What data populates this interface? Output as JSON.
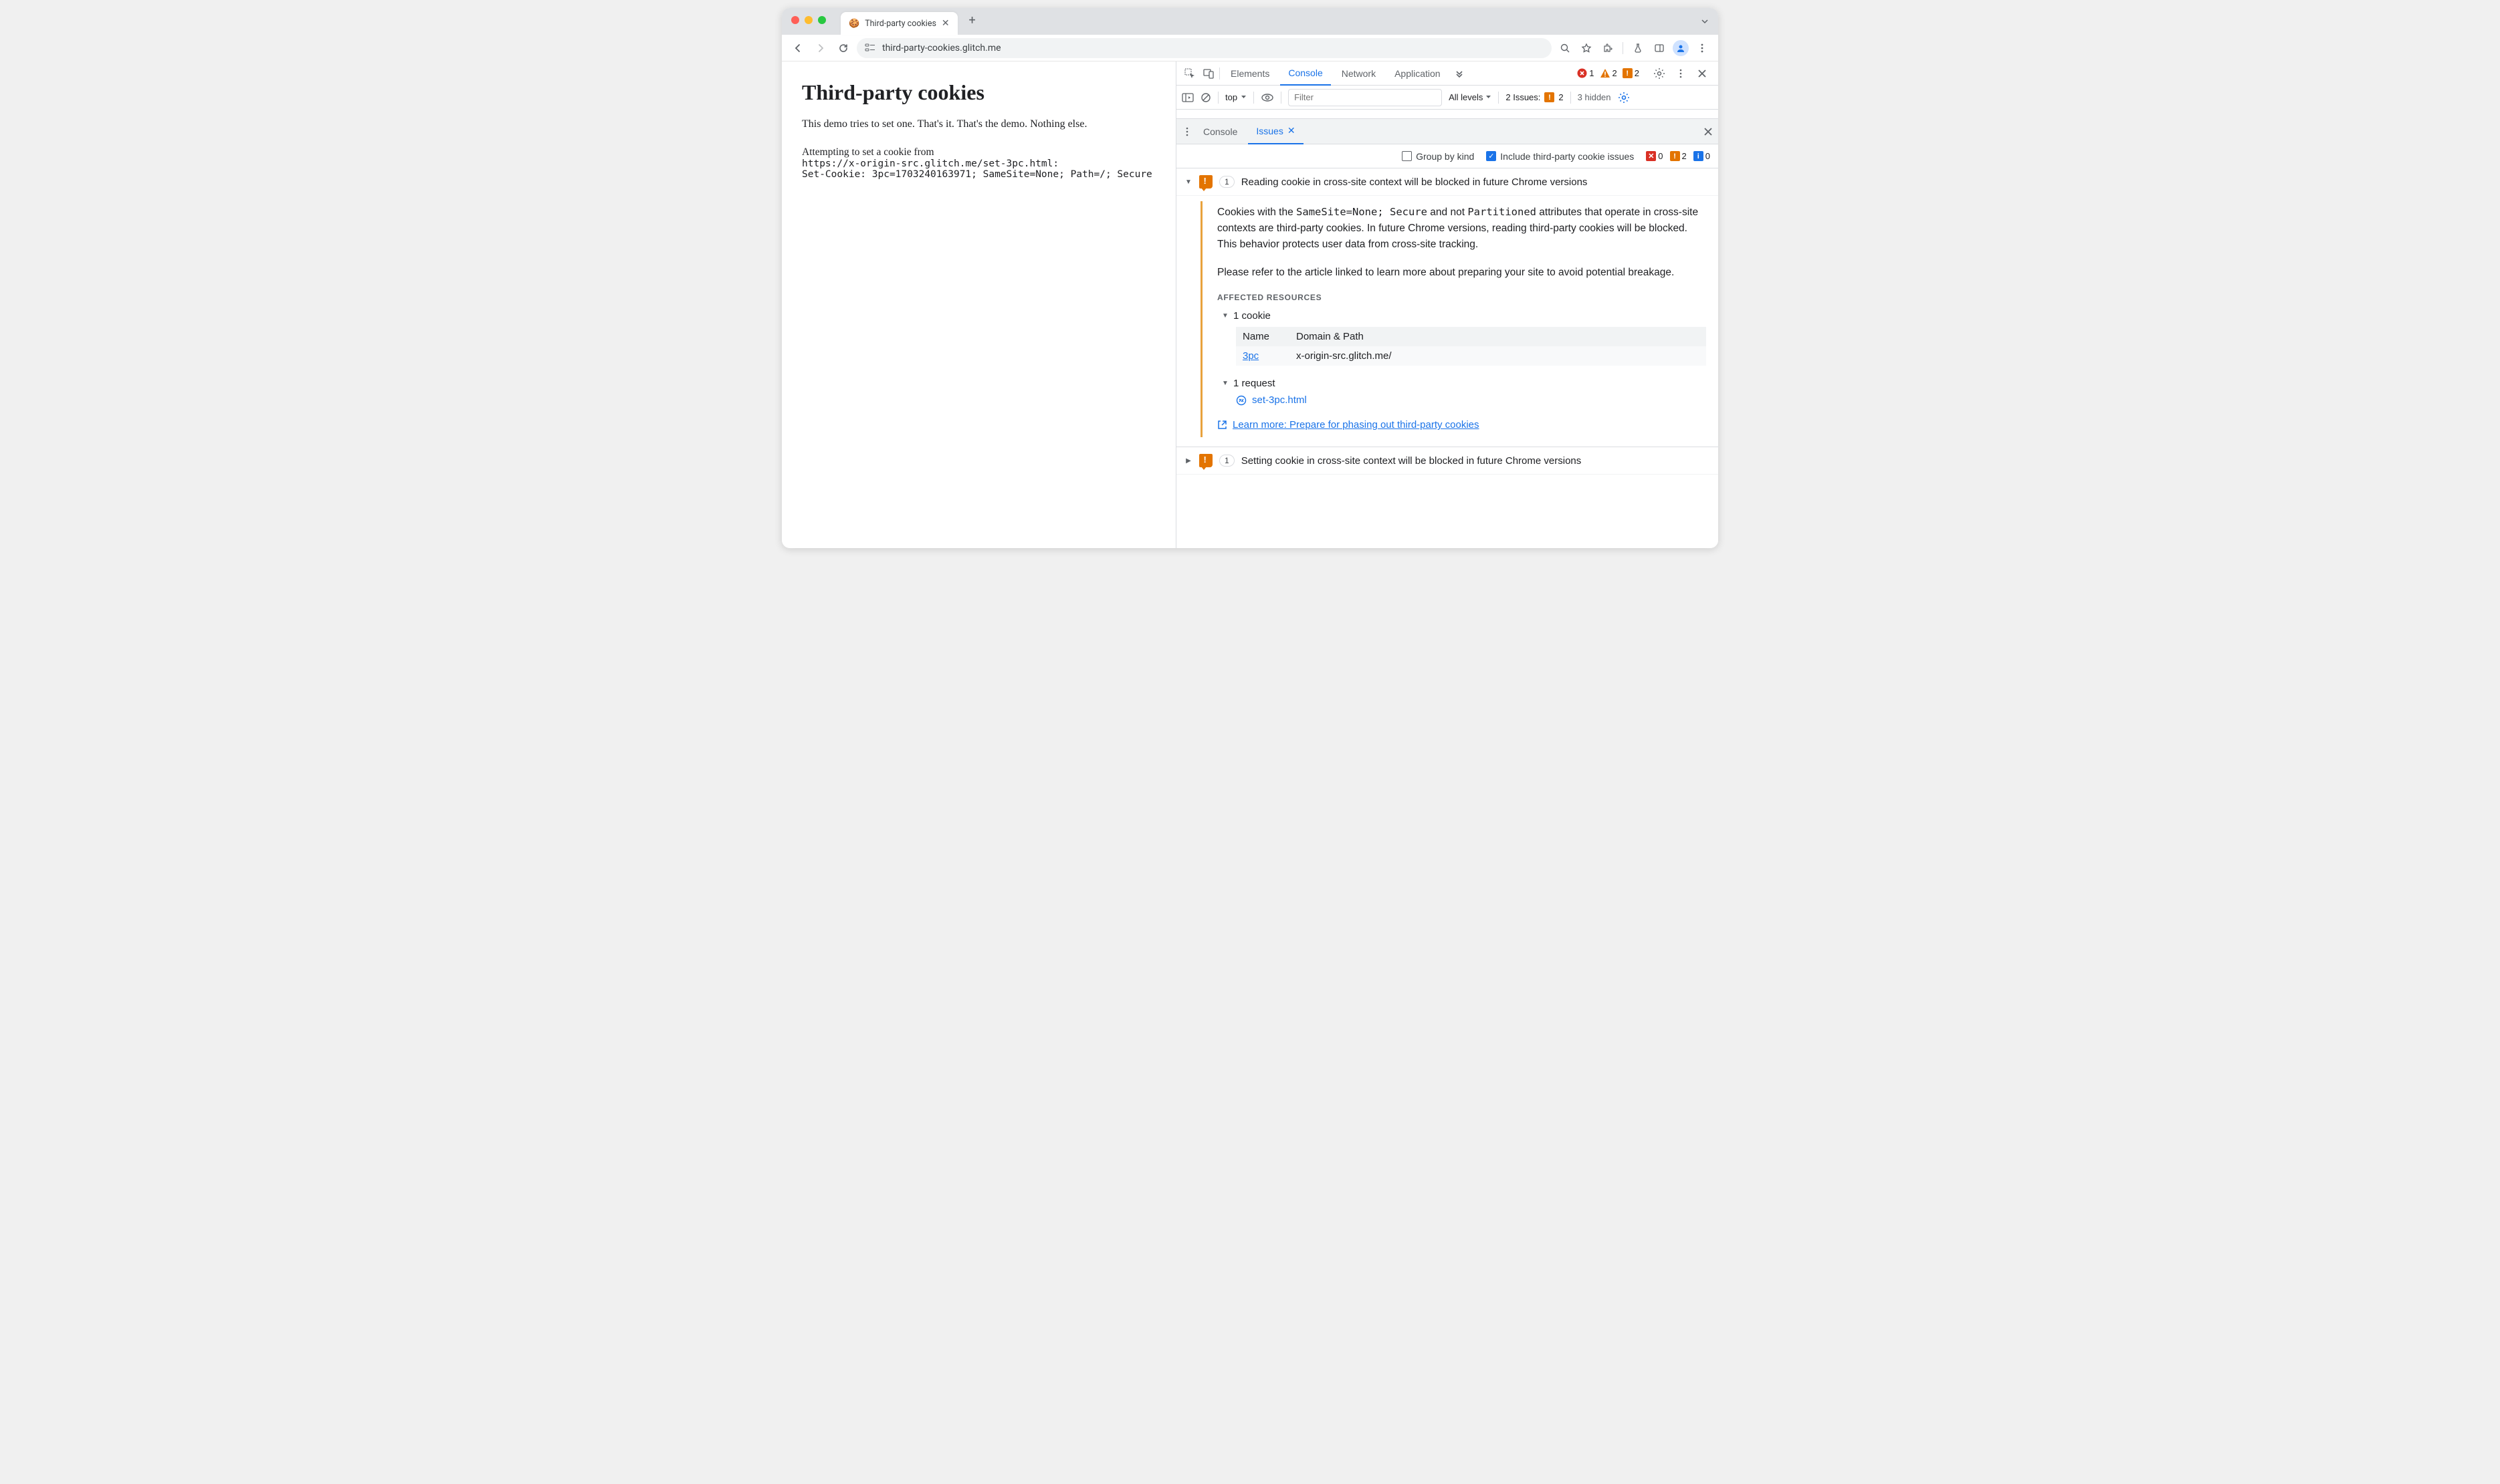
{
  "browser": {
    "tab_title": "Third-party cookies",
    "url": "third-party-cookies.glitch.me"
  },
  "page": {
    "h1": "Third-party cookies",
    "intro": "This demo tries to set one. That's it. That's the demo. Nothing else.",
    "attempt_line1": "Attempting to set a cookie from",
    "attempt_url": "https://x-origin-src.glitch.me/set-3pc.html:",
    "set_cookie": "Set-Cookie: 3pc=1703240163971; SameSite=None; Path=/; Secure"
  },
  "devtools": {
    "tabs": [
      "Elements",
      "Console",
      "Network",
      "Application"
    ],
    "active_tab": "Console",
    "error_count": "1",
    "warn_count": "2",
    "issue_count_top": "2",
    "filterbar": {
      "context": "top",
      "filter_placeholder": "Filter",
      "levels": "All levels",
      "issues_label": "2 Issues:",
      "issues_badge": "2",
      "hidden": "3 hidden"
    },
    "drawer": {
      "tabs": [
        "Console",
        "Issues"
      ],
      "active": "Issues"
    },
    "issues_toolbar": {
      "group_label": "Group by kind",
      "include_label": "Include third-party cookie issues",
      "counts": {
        "red": "0",
        "orange": "2",
        "blue": "0"
      }
    },
    "issues": [
      {
        "expanded": true,
        "count": "1",
        "title": "Reading cookie in cross-site context will be blocked in future Chrome versions",
        "body_p1_a": "Cookies with the ",
        "body_p1_code": "SameSite=None; Secure",
        "body_p1_b": " and not ",
        "body_p1_code2": "Partitioned",
        "body_p1_c": " attributes that operate in cross-site contexts are third-party cookies. In future Chrome versions, reading third-party cookies will be blocked. This behavior protects user data from cross-site tracking.",
        "body_p2": "Please refer to the article linked to learn more about preparing your site to avoid potential breakage.",
        "affected_heading": "AFFECTED RESOURCES",
        "cookie_count": "1 cookie",
        "tbl_name": "Name",
        "tbl_domain": "Domain & Path",
        "cookie_name": "3pc",
        "cookie_domain": "x-origin-src.glitch.me/",
        "request_count": "1 request",
        "request_link": "set-3pc.html",
        "learn_more": "Learn more: Prepare for phasing out third-party cookies"
      },
      {
        "expanded": false,
        "count": "1",
        "title": "Setting cookie in cross-site context will be blocked in future Chrome versions"
      }
    ]
  }
}
